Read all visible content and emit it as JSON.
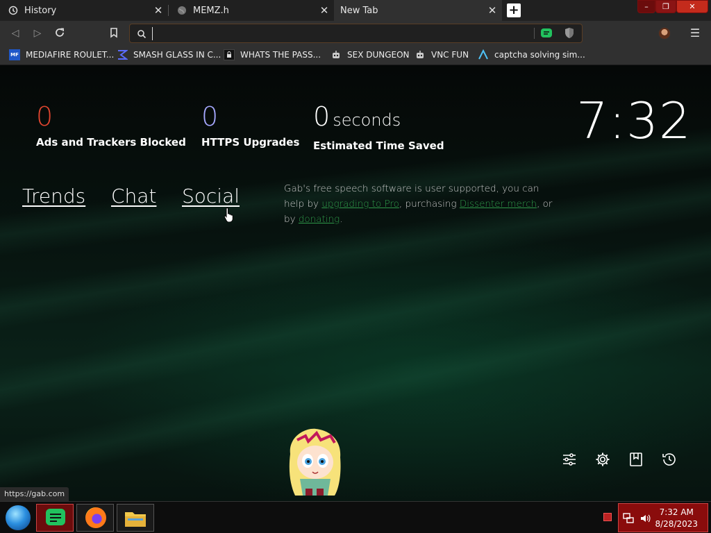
{
  "browser": {
    "tabs": [
      {
        "label": "History",
        "icon": "history-icon",
        "active": false
      },
      {
        "label": "MEMZ.h",
        "icon": "globe-icon",
        "active": false
      },
      {
        "label": "New Tab",
        "icon": "",
        "active": true
      }
    ],
    "address_bar": {
      "value": "",
      "placeholder": ""
    },
    "bookmarks": [
      {
        "label": "MEDIAFIRE ROULET...",
        "icon": "mediafire-icon"
      },
      {
        "label": "SMASH GLASS IN C...",
        "icon": "smash-icon"
      },
      {
        "label": "WHATS THE PASS...",
        "icon": "lock-icon"
      },
      {
        "label": "SEX DUNGEON",
        "icon": "robot-icon"
      },
      {
        "label": "VNC FUN",
        "icon": "robot-icon"
      },
      {
        "label": "captcha solving sim...",
        "icon": "a-icon"
      }
    ],
    "status_url": "https://gab.com"
  },
  "newtab": {
    "stats": [
      {
        "value": "0",
        "unit": "",
        "label": "Ads and Trackers Blocked",
        "color": "#e0452f"
      },
      {
        "value": "0",
        "unit": "",
        "label": "HTTPS Upgrades",
        "color": "#a6a8ff"
      },
      {
        "value": "0",
        "unit": "seconds",
        "label": "Estimated Time Saved",
        "color": "#ffffff"
      }
    ],
    "clock": "7:32",
    "links": [
      "Trends",
      "Chat",
      "Social"
    ],
    "sponsor": {
      "line1": "Gab's free speech software is user supported, you can",
      "help_prefix": "help by ",
      "link_pro": "upgrading to Pro",
      "mid": ", purchasing ",
      "link_merch": "Dissenter merch",
      "end": ", or",
      "by": "by ",
      "link_donate": "donating",
      "period": "."
    }
  },
  "taskbar": {
    "time": "7:32 AM",
    "date": "8/28/2023"
  },
  "colors": {
    "accent_red": "#e0452f",
    "accent_purple": "#a6a8ff",
    "link_green": "#2f9a4a",
    "tray_red": "#8a0c0c"
  }
}
